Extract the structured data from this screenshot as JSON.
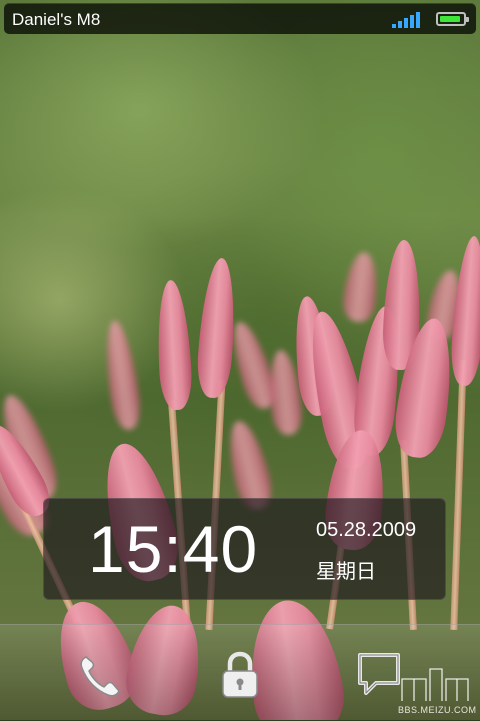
{
  "status_bar": {
    "device_name": "Daniel's M8",
    "signal_bars": 5,
    "battery_level": 0.9,
    "icons": [
      "signal-icon",
      "battery-icon"
    ]
  },
  "clock": {
    "time": "15:40",
    "date": "05.28.2009",
    "weekday": "星期日"
  },
  "dock": {
    "buttons": [
      {
        "name": "phone",
        "icon": "phone-icon"
      },
      {
        "name": "unlock",
        "icon": "lock-icon"
      },
      {
        "name": "messages",
        "icon": "message-icon"
      }
    ]
  },
  "watermark": {
    "text": "BBS.MEIZU.COM"
  },
  "colors": {
    "signal": "#37a8ff",
    "battery": "#3fe63a"
  }
}
